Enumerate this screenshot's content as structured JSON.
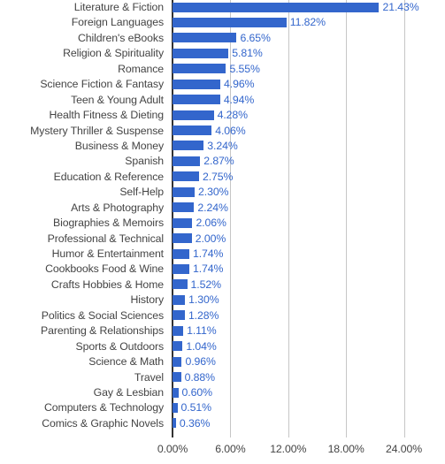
{
  "chart": {
    "type": "bar",
    "orientation": "horizontal",
    "accent_color": "#3366cc",
    "label_color": "#444444",
    "gridline_color": "#c6c6c6",
    "axis_color": "#333333"
  },
  "chart_data": {
    "type": "bar",
    "title": "",
    "xlabel": "",
    "ylabel": "",
    "grid": true,
    "legend": false,
    "xlim": [
      0,
      24
    ],
    "xticks": [
      "0.00%",
      "6.00%",
      "12.00%",
      "18.00%",
      "24.00%"
    ],
    "xtick_values": [
      0,
      6,
      12,
      18,
      24
    ],
    "categories": [
      "Literature & Fiction",
      "Foreign Languages",
      "Children's eBooks",
      "Religion & Spirituality",
      "Romance",
      "Science Fiction & Fantasy",
      "Teen & Young Adult",
      "Health Fitness & Dieting",
      "Mystery Thriller & Suspense",
      "Business & Money",
      "Spanish",
      "Education & Reference",
      "Self-Help",
      "Arts & Photography",
      "Biographies & Memoirs",
      "Professional & Technical",
      "Humor & Entertainment",
      "Cookbooks Food & Wine",
      "Crafts Hobbies & Home",
      "History",
      "Politics & Social Sciences",
      "Parenting & Relationships",
      "Sports & Outdoors",
      "Science & Math",
      "Travel",
      "Gay & Lesbian",
      "Computers & Technology",
      "Comics & Graphic Novels"
    ],
    "values": [
      21.43,
      11.82,
      6.65,
      5.81,
      5.55,
      4.96,
      4.94,
      4.28,
      4.06,
      3.24,
      2.87,
      2.75,
      2.3,
      2.24,
      2.06,
      2.0,
      1.74,
      1.74,
      1.52,
      1.3,
      1.28,
      1.11,
      1.04,
      0.96,
      0.88,
      0.6,
      0.51,
      0.36
    ],
    "data_labels": [
      "21.43%",
      "11.82%",
      "6.65%",
      "5.81%",
      "5.55%",
      "4.96%",
      "4.94%",
      "4.28%",
      "4.06%",
      "3.24%",
      "2.87%",
      "2.75%",
      "2.30%",
      "2.24%",
      "2.06%",
      "2.00%",
      "1.74%",
      "1.74%",
      "1.52%",
      "1.30%",
      "1.28%",
      "1.11%",
      "1.04%",
      "0.96%",
      "0.88%",
      "0.60%",
      "0.51%",
      "0.36%"
    ]
  }
}
